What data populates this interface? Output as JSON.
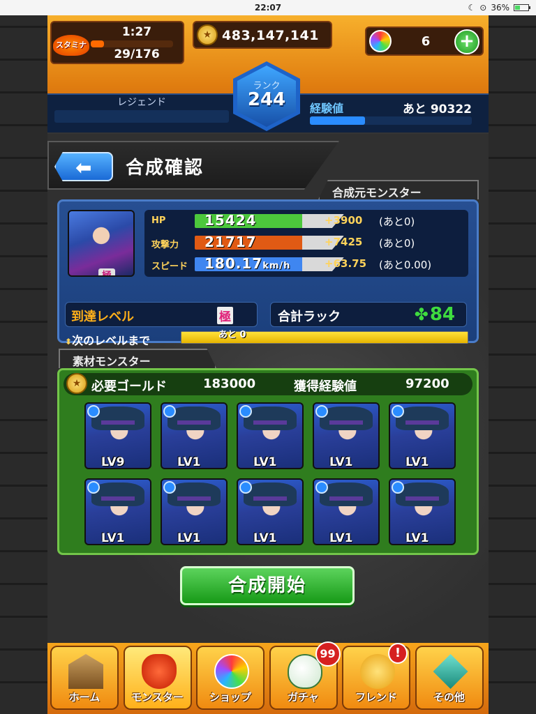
{
  "status_bar": {
    "time": "22:07",
    "battery": "36%"
  },
  "header": {
    "stamina_label": "スタミナ",
    "stamina_timer": "1:27",
    "stamina": "29/176",
    "stamina_fill": 0.16,
    "gold": "483,147,141",
    "orbs": "6",
    "rank_label": "ランク",
    "rank": "244",
    "rank_title": "レジェンド",
    "exp_label": "経験値",
    "exp_remaining": "あと 90322",
    "exp_fill": 0.34
  },
  "page": {
    "title": "合成確認",
    "back_icon": "back-arrow-icon"
  },
  "base_monster": {
    "section_label": "合成元モンスター",
    "grade_badge": "極",
    "stats": [
      {
        "name": "HP",
        "value": "15424",
        "unit": "",
        "plus": "+3900",
        "rest": "(あと0)",
        "color": "#4cc83c"
      },
      {
        "name": "攻撃力",
        "value": "21717",
        "unit": "",
        "plus": "+7425",
        "rest": "(あと0)",
        "color": "#e05a14"
      },
      {
        "name": "スピード",
        "value": "180.17",
        "unit": "km/h",
        "plus": "+63.75",
        "rest": "(あと0.00)",
        "color": "#3f86f0"
      }
    ],
    "reach_level_label": "到達レベル",
    "reach_level_value": "極",
    "luck_label": "合計ラック",
    "luck_value": "84",
    "next_level_label": "次のレベルまで",
    "next_level_rest": "あと 0",
    "next_level_fill": 1.0
  },
  "materials": {
    "section_label": "素材モンスター",
    "gold_label": "必要ゴールド",
    "gold_value": "183000",
    "exp_label": "獲得経験値",
    "exp_value": "97200",
    "monsters": [
      {
        "level": "LV9"
      },
      {
        "level": "LV1"
      },
      {
        "level": "LV1"
      },
      {
        "level": "LV1"
      },
      {
        "level": "LV1"
      },
      {
        "level": "LV1"
      },
      {
        "level": "LV1"
      },
      {
        "level": "LV1"
      },
      {
        "level": "LV1"
      },
      {
        "level": "LV1"
      }
    ]
  },
  "start_button": "合成開始",
  "nav": [
    {
      "label": "ホーム",
      "icon": "home-icon"
    },
    {
      "label": "モンスター",
      "icon": "monster-icon",
      "active": true
    },
    {
      "label": "ショップ",
      "icon": "shop-orb-icon"
    },
    {
      "label": "ガチャ",
      "icon": "gacha-egg-icon",
      "badge": "99"
    },
    {
      "label": "フレンド",
      "icon": "friend-icon",
      "badge": "!"
    },
    {
      "label": "その他",
      "icon": "other-icon"
    }
  ]
}
